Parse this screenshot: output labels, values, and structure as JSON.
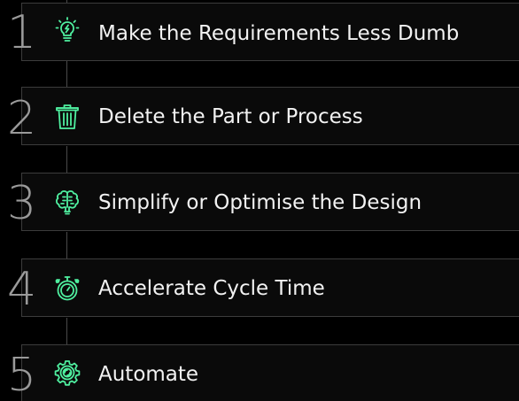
{
  "accent_color": "#4ff0a0",
  "steps": [
    {
      "number": "1",
      "label": "Make the Requirements Less Dumb",
      "icon": "lightbulb-icon"
    },
    {
      "number": "2",
      "label": "Delete the Part or Process",
      "icon": "trash-icon"
    },
    {
      "number": "3",
      "label": "Simplify or Optimise the Design",
      "icon": "brain-icon"
    },
    {
      "number": "4",
      "label": "Accelerate Cycle Time",
      "icon": "stopwatch-icon"
    },
    {
      "number": "5",
      "label": "Automate",
      "icon": "gear-icon"
    }
  ]
}
